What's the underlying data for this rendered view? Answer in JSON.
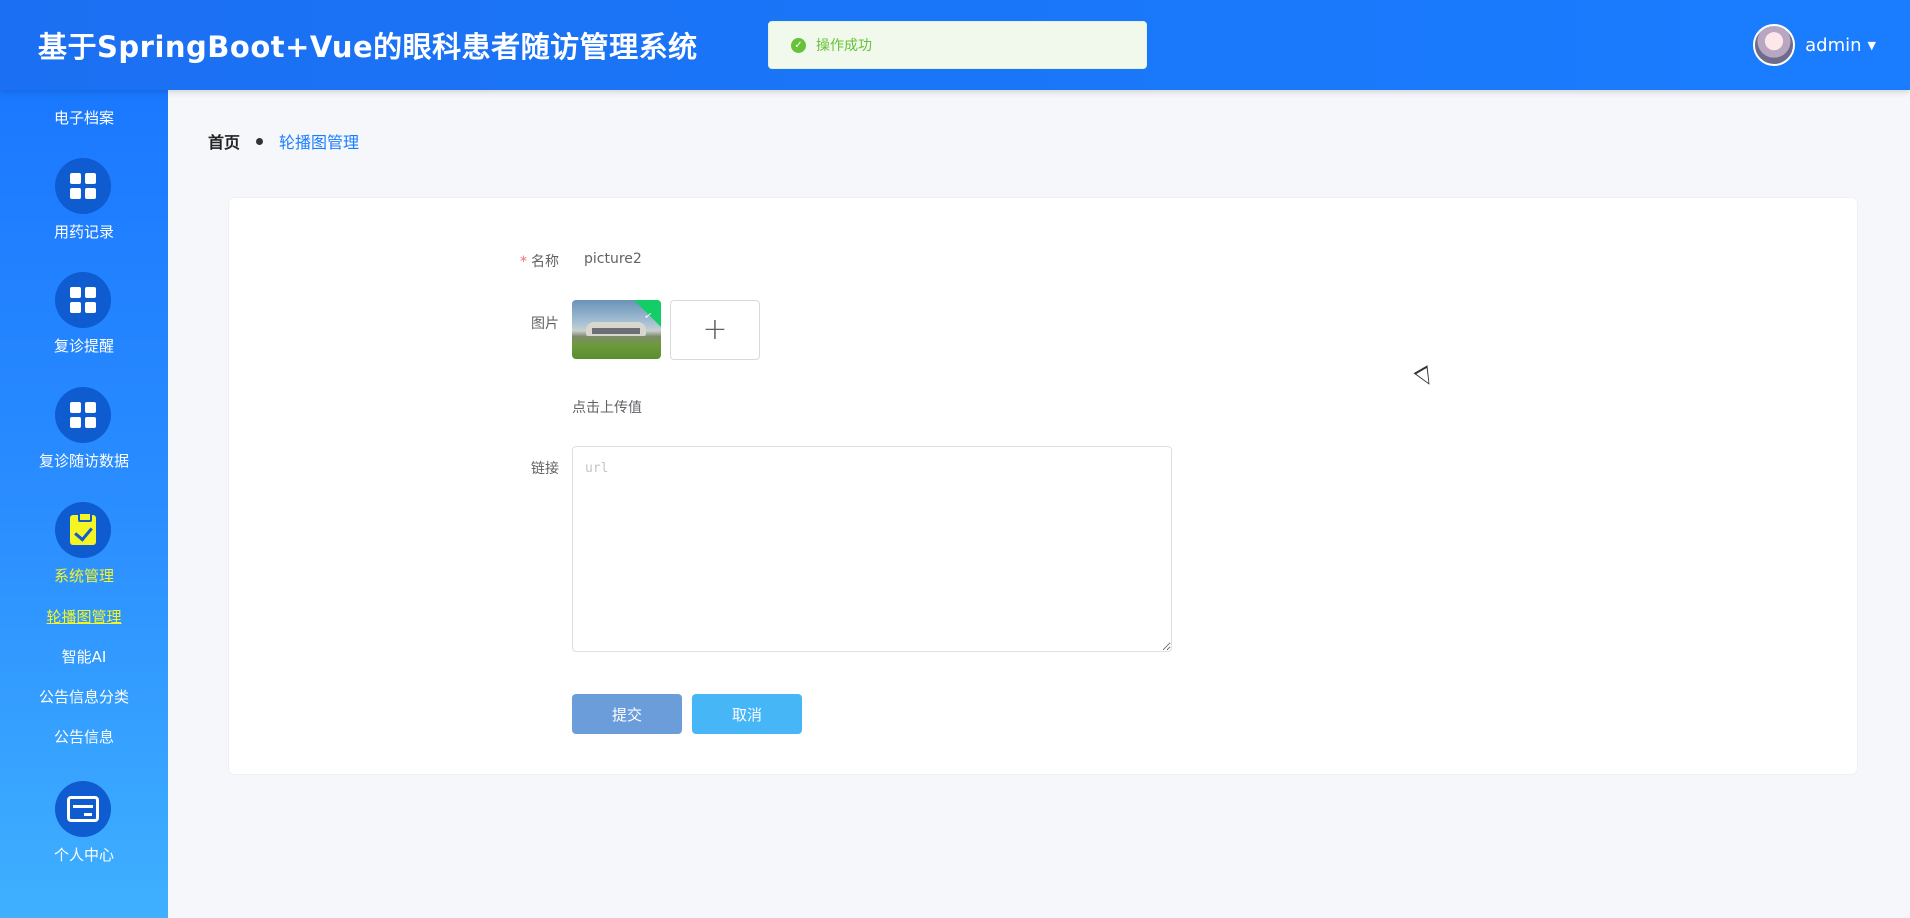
{
  "header": {
    "title": "基于SpringBoot+Vue的眼科患者随访管理系统",
    "toast": {
      "icon": "check-circle-icon",
      "text": "操作成功"
    },
    "user": {
      "name": "admin",
      "avatar": "avatar-image",
      "caret": "▼"
    }
  },
  "sidebar": {
    "items": [
      {
        "label": "电子档案",
        "icon": ""
      },
      {
        "label": "用药记录",
        "icon": "grid-icon"
      },
      {
        "label": "复诊提醒",
        "icon": "grid-icon"
      },
      {
        "label": "复诊随访数据",
        "icon": "grid-icon"
      },
      {
        "label": "系统管理",
        "icon": "clipboard-check-icon",
        "active": true
      },
      {
        "label": "个人中心",
        "icon": "card-icon"
      }
    ],
    "sub_items": [
      {
        "label": "轮播图管理",
        "active": true
      },
      {
        "label": "智能AI"
      },
      {
        "label": "公告信息分类"
      },
      {
        "label": "公告信息"
      }
    ]
  },
  "breadcrumb": {
    "home": "首页",
    "current": "轮播图管理"
  },
  "form": {
    "name_label": "名称",
    "name_required": "*",
    "name_value": "picture2",
    "image_label": "图片",
    "upload_tip": "点击上传值",
    "upload_plus": "+",
    "link_label": "链接",
    "link_placeholder": "url",
    "link_value": "",
    "submit_label": "提交",
    "cancel_label": "取消"
  },
  "colors": {
    "header": "#1a78ff",
    "active_menu": "#f5f524",
    "submit": "#6b9ddb",
    "cancel": "#46b6f7",
    "toast_success": "#67c23a"
  }
}
